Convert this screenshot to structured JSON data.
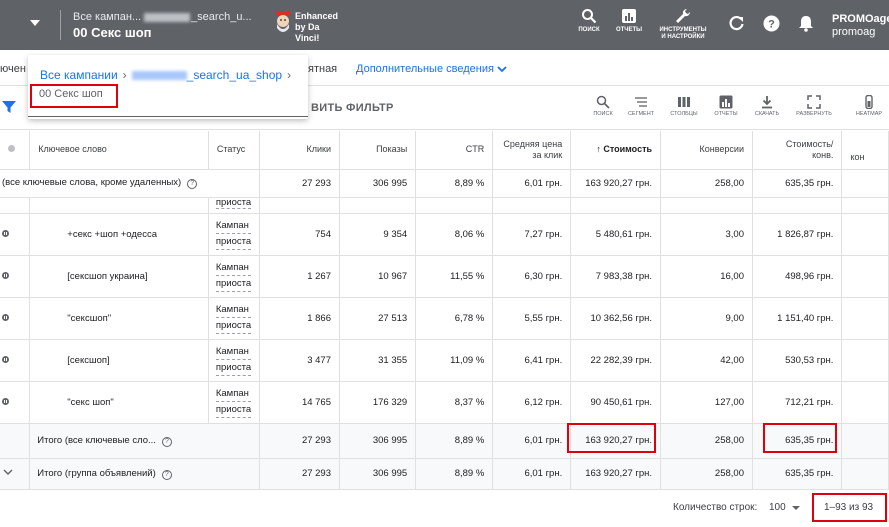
{
  "header": {
    "breadcrumb_prefix": "Все кампан...",
    "breadcrumb_suffix": "_search_u...",
    "title": "00 Секс шоп",
    "extension_name": "Enhanced by Da Vinci!",
    "extension_lines": [
      "Enhanced",
      "by Da",
      "Vinci!"
    ],
    "tools": [
      {
        "icon": "search-icon",
        "label": "поиск"
      },
      {
        "icon": "reports-icon",
        "label": "отчеты"
      },
      {
        "icon": "wrench-icon",
        "label_line1": "инструменты",
        "label_line2": "и настройки"
      }
    ],
    "account_name": "PROMOagen",
    "account_sub": "promoag"
  },
  "subnav": {
    "left_fragment": "ючен",
    "mid_fragment": "ятная",
    "more_details": "Дополнительные сведения"
  },
  "popup": {
    "all_campaigns": "Все кампании",
    "campaign": "_search_ua_shop",
    "ad_group": "00 Секс шоп"
  },
  "filterbar": {
    "add_filter": "ВИТЬ ФИЛЬТР",
    "tools": [
      "поиск",
      "сегмент",
      "столбцы",
      "отчеты",
      "скачать",
      "развернуть",
      "heatmap"
    ]
  },
  "table": {
    "headers": {
      "keyword": "Ключевое слово",
      "status": "Статус",
      "clicks": "Клики",
      "impressions": "Показы",
      "ctr": "CTR",
      "avg_cpc_line1": "Средняя цена",
      "avg_cpc_line2": "за клик",
      "cost": "Стоимость",
      "conversions": "Конверсии",
      "cost_conv_line1": "Стоимость/",
      "cost_conv_line2": "конв.",
      "last_cut": "кон"
    },
    "total_all": {
      "label": "(все ключевые слова, кроме удаленных)",
      "clicks": "27 293",
      "impressions": "306 995",
      "ctr": "8,89 %",
      "avg_cpc": "6,01 грн.",
      "cost": "163 920,27 грн.",
      "conversions": "258,00",
      "cost_conv": "635,35 грн."
    },
    "rows": [
      {
        "keyword": "",
        "status1": "",
        "status2": "приоста",
        "clicks": "",
        "impressions": "",
        "ctr": "",
        "avg_cpc": "",
        "cost": "",
        "conversions": "",
        "cost_conv": ""
      },
      {
        "keyword": "+секс +шоп +одесса",
        "status1": "Кампан",
        "status2": "приоста",
        "clicks": "754",
        "impressions": "9 354",
        "ctr": "8,06 %",
        "avg_cpc": "7,27 грн.",
        "cost": "5 480,61 грн.",
        "conversions": "3,00",
        "cost_conv": "1 826,87 грн."
      },
      {
        "keyword": "[сексшоп украина]",
        "status1": "Кампан",
        "status2": "приоста",
        "clicks": "1 267",
        "impressions": "10 967",
        "ctr": "11,55 %",
        "avg_cpc": "6,30 грн.",
        "cost": "7 983,38 грн.",
        "conversions": "16,00",
        "cost_conv": "498,96 грн."
      },
      {
        "keyword": "\"сексшоп\"",
        "status1": "Кампан",
        "status2": "приоста",
        "clicks": "1 866",
        "impressions": "27 513",
        "ctr": "6,78 %",
        "avg_cpc": "5,55 грн.",
        "cost": "10 362,56 грн.",
        "conversions": "9,00",
        "cost_conv": "1 151,40 грн."
      },
      {
        "keyword": "[сексшоп]",
        "status1": "Кампан",
        "status2": "приоста",
        "clicks": "3 477",
        "impressions": "31 355",
        "ctr": "11,09 %",
        "avg_cpc": "6,41 грн.",
        "cost": "22 282,39 грн.",
        "conversions": "42,00",
        "cost_conv": "530,53 грн."
      },
      {
        "keyword": "\"секс шоп\"",
        "status1": "Кампан",
        "status2": "приоста",
        "clicks": "14 765",
        "impressions": "176 329",
        "ctr": "8,37 %",
        "avg_cpc": "6,12 грн.",
        "cost": "90 450,61 грн.",
        "conversions": "127,00",
        "cost_conv": "712,21 грн."
      }
    ],
    "total_keywords": {
      "label": "Итого (все ключевые сло...",
      "clicks": "27 293",
      "impressions": "306 995",
      "ctr": "8,89 %",
      "avg_cpc": "6,01 грн.",
      "cost": "163 920,27 грн.",
      "conversions": "258,00",
      "cost_conv": "635,35 грн."
    },
    "total_adgroup": {
      "label": "Итого (группа объявлений)",
      "clicks": "27 293",
      "impressions": "306 995",
      "ctr": "8,89 %",
      "avg_cpc": "6,01 грн.",
      "cost": "163 920,27 грн.",
      "conversions": "258,00",
      "cost_conv": "635,35 грн."
    }
  },
  "footer": {
    "rows_label": "Количество строк:",
    "rows_value": "100",
    "range": "1–93 из 93"
  },
  "colors": {
    "header_bg": "#5f6368",
    "accent_blue": "#1a73e8",
    "highlight_red": "#e0000b"
  }
}
